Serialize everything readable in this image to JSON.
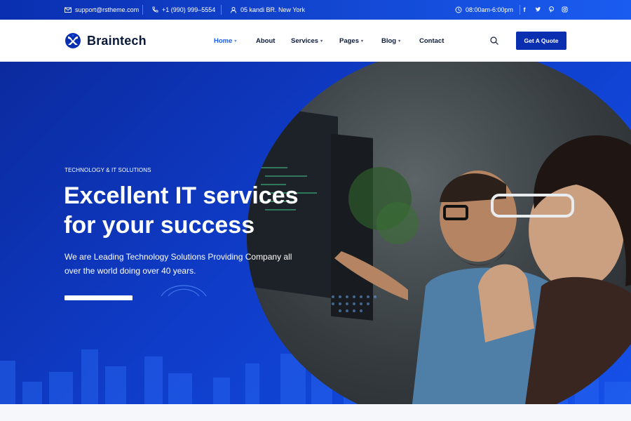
{
  "topbar": {
    "email": "support@rstheme.com",
    "phone": "+1 (990) 999–5554",
    "address": "05 kandi BR. New York",
    "hours": "08:00am-6:00pm",
    "social": [
      "f",
      "t",
      "p",
      "ig"
    ]
  },
  "brand": {
    "name": "Braintech"
  },
  "nav": {
    "items": [
      {
        "label": "Home",
        "has_caret": true
      },
      {
        "label": "About",
        "has_caret": false
      },
      {
        "label": "Services",
        "has_caret": true
      },
      {
        "label": "Pages",
        "has_caret": true
      },
      {
        "label": "Blog",
        "has_caret": true
      },
      {
        "label": "Contact",
        "has_caret": false
      }
    ],
    "active": "Home",
    "quote_button": "Get A Quote"
  },
  "hero": {
    "eyebrow": "TECHNOLOGY & IT SOLUTIONS",
    "title_line1": "Excellent IT services",
    "title_line2": "for your success",
    "description": "We are Leading Technology Solutions Providing Company all over the world doing over 40 years."
  },
  "colors": {
    "primary": "#0a2fb0",
    "accent": "#1a5cf0",
    "dark": "#0b1a3a"
  }
}
